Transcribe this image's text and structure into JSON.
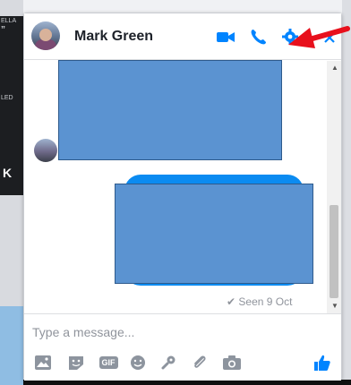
{
  "background": {
    "left_text_top": "ELLA",
    "left_text_quote": "”",
    "left_text_mid": "LED",
    "left_letter": "K"
  },
  "chat": {
    "contact_name": "Mark Green",
    "header_icons": [
      "video-camera-icon",
      "phone-icon",
      "gear-icon",
      "close-icon"
    ],
    "seen_status": "✔ Seen 9 Oct",
    "composer_placeholder": "Type a message...",
    "toolbar_icons": [
      "photo-icon",
      "sticker-icon",
      "gif-icon",
      "emoji-icon",
      "games-icon",
      "attachment-icon",
      "camera-icon",
      "like-icon"
    ],
    "gif_label": "GIF",
    "colors": {
      "accent": "#0084ff",
      "bubble": "#0b8bf1",
      "redaction_fill": "#5b93d1",
      "annotation_arrow": "#e8101c"
    }
  }
}
